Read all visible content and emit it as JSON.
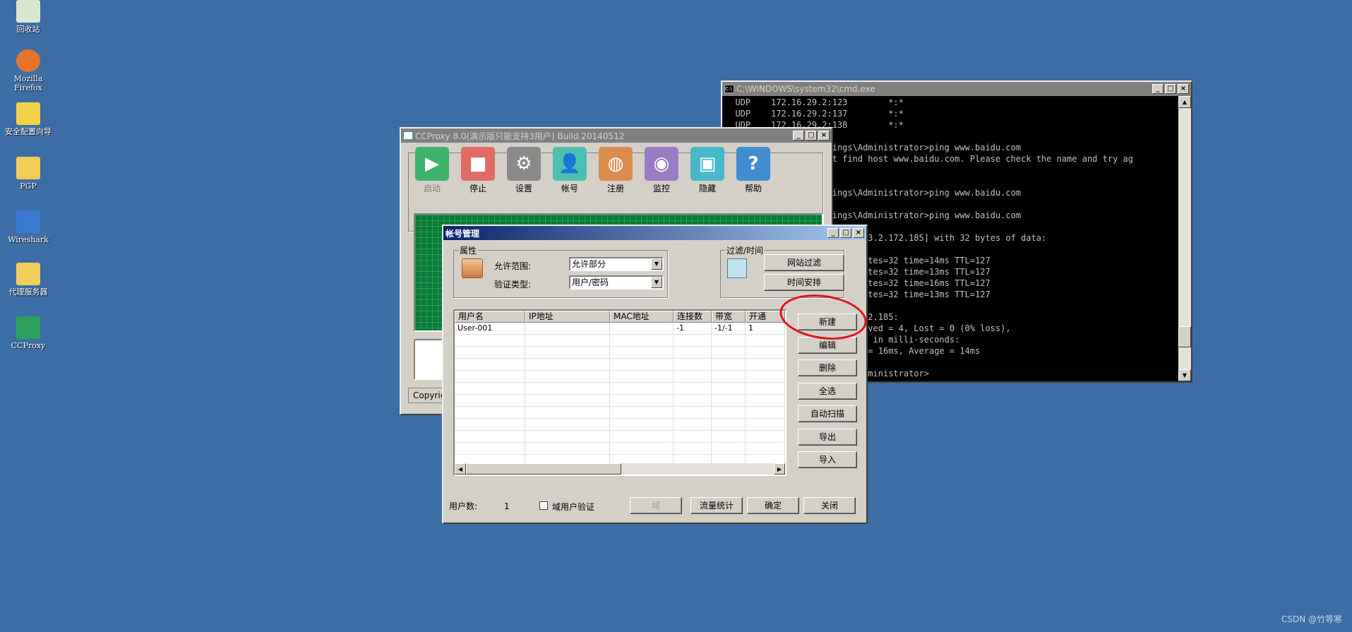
{
  "desktop": {
    "icons": [
      {
        "label": "回收站",
        "icon": "recycle-bin-icon"
      },
      {
        "label": "Mozilla Firefox",
        "icon": "firefox-icon"
      },
      {
        "label": "安全配置向导",
        "icon": "security-wizard-icon"
      },
      {
        "label": "PGP",
        "icon": "folder-icon"
      },
      {
        "label": "Wireshark",
        "icon": "wireshark-icon"
      },
      {
        "label": "代理服务器",
        "icon": "folder-icon"
      },
      {
        "label": "CCProxy",
        "icon": "ccproxy-icon"
      }
    ],
    "watermark": "CSDN @竹等寒"
  },
  "cmd": {
    "title": "C:\\WINDOWS\\system32\\cmd.exe",
    "lines": [
      "  UDP    172.16.29.2:123        *:*",
      "  UDP    172.16.29.2:137        *:*",
      "  UDP    172.16.29.2:138        *:*",
      "",
      "C:\\Documents and Settings\\Administrator>ping www.baidu.com",
      "Ping request could not find host www.baidu.com. Please check the name and try ag",
      "",
      "",
      "C:\\Documents and Settings\\Administrator>ping www.baidu.com",
      "",
      "C:\\Documents and Settings\\Administrator>ping www.baidu.com",
      "",
      "Pinging www.a.shifen.com [183.2.172.185] with 32 bytes of data:",
      "",
      "Reply from 183.2.172.185: bytes=32 time=14ms TTL=127",
      "Reply from 183.2.172.185: bytes=32 time=13ms TTL=127",
      "Reply from 183.2.172.185: bytes=32 time=16ms TTL=127",
      "Reply from 183.2.172.185: bytes=32 time=13ms TTL=127",
      "",
      "Ping statistics for 183.2.172.185:",
      "    Packets: Sent = 4, Received = 4, Lost = 0 (0% loss),",
      "Approximate round trip times in milli-seconds:",
      "    Minimum = 13ms, Maximum = 16ms, Average = 14ms",
      "",
      "C:\\Documents and Settings\\Administrator>"
    ]
  },
  "ccproxy": {
    "title": "CCProxy 8.0(演示版只能支持3用户) Build 20140512",
    "toolbar": [
      {
        "label": "启动",
        "icon": "play-icon",
        "color": "#3db36b"
      },
      {
        "label": "停止",
        "icon": "stop-icon",
        "color": "#e06c66"
      },
      {
        "label": "设置",
        "icon": "gear-icon",
        "color": "#8a8a8a"
      },
      {
        "label": "帐号",
        "icon": "user-icon",
        "color": "#4dbfb0"
      },
      {
        "label": "注册",
        "icon": "globe-icon",
        "color": "#d98c4e"
      },
      {
        "label": "监控",
        "icon": "eye-icon",
        "color": "#9a7cc4"
      },
      {
        "label": "隐藏",
        "icon": "hide-icon",
        "color": "#46b8c9"
      },
      {
        "label": "帮助",
        "icon": "help-icon",
        "color": "#3f8dd0"
      }
    ],
    "status": "Copyrigh"
  },
  "account": {
    "title": "帐号管理",
    "props_title": "属性",
    "allow_label": "允许范围:",
    "allow_value": "允许部分",
    "auth_label": "验证类型:",
    "auth_value": "用户/密码",
    "filter_title": "过滤/时间",
    "web_filter": "网站过滤",
    "time_schedule": "时间安排",
    "columns": [
      "用户名",
      "IP地址",
      "MAC地址",
      "连接数",
      "带宽",
      "开通"
    ],
    "rows": [
      [
        "User-001",
        "",
        "",
        "-1",
        "-1/-1",
        "1"
      ]
    ],
    "side_buttons": [
      "新建",
      "编辑",
      "删除",
      "全选",
      "自动扫描",
      "导出",
      "导入"
    ],
    "user_count_label": "用户数:",
    "user_count": "1",
    "domain_auth_label": "域用户验证",
    "btn_domain": "域",
    "btn_traffic": "流量统计",
    "btn_ok": "确定",
    "btn_close": "关闭"
  }
}
